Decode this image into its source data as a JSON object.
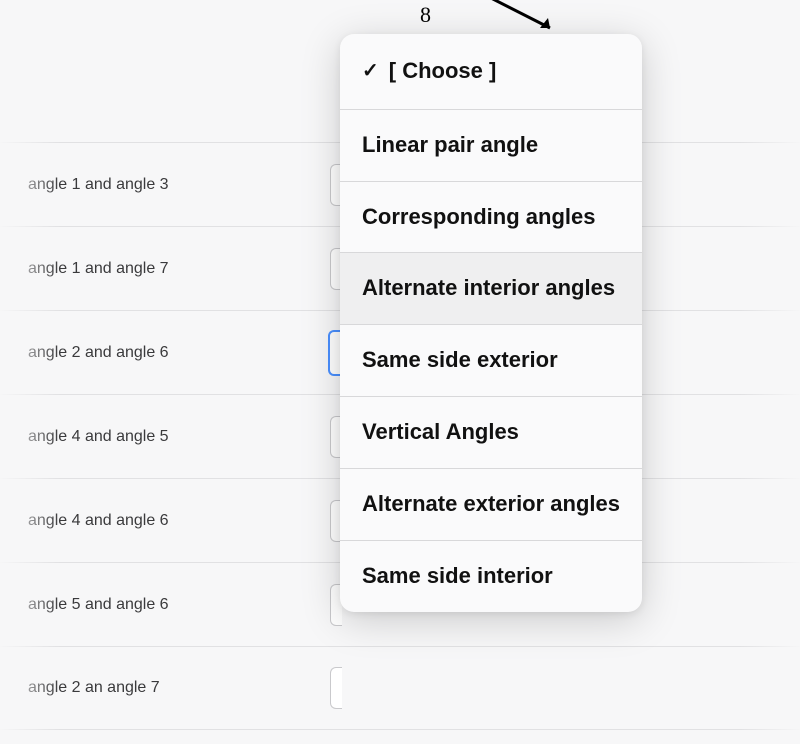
{
  "diagram": {
    "hint_char": "8"
  },
  "rows": [
    {
      "label": "angle 1 and angle 3"
    },
    {
      "label": "angle 1 and angle 7"
    },
    {
      "label": "angle 2 and angle 6",
      "active": true
    },
    {
      "label": "angle 4 and angle 5"
    },
    {
      "label": "angle 4 and angle 6"
    },
    {
      "label": "angle 5 and angle 6"
    },
    {
      "label": "angle 2 an angle 7"
    }
  ],
  "dropdown": {
    "selected_label": "[ Choose ]",
    "check_glyph": "✓",
    "options": [
      "Linear pair angle",
      "Corresponding angles",
      "Alternate interior angles",
      "Same side exterior",
      "Vertical Angles",
      "Alternate exterior angles",
      "Same side interior"
    ],
    "highlighted_index": 2
  }
}
